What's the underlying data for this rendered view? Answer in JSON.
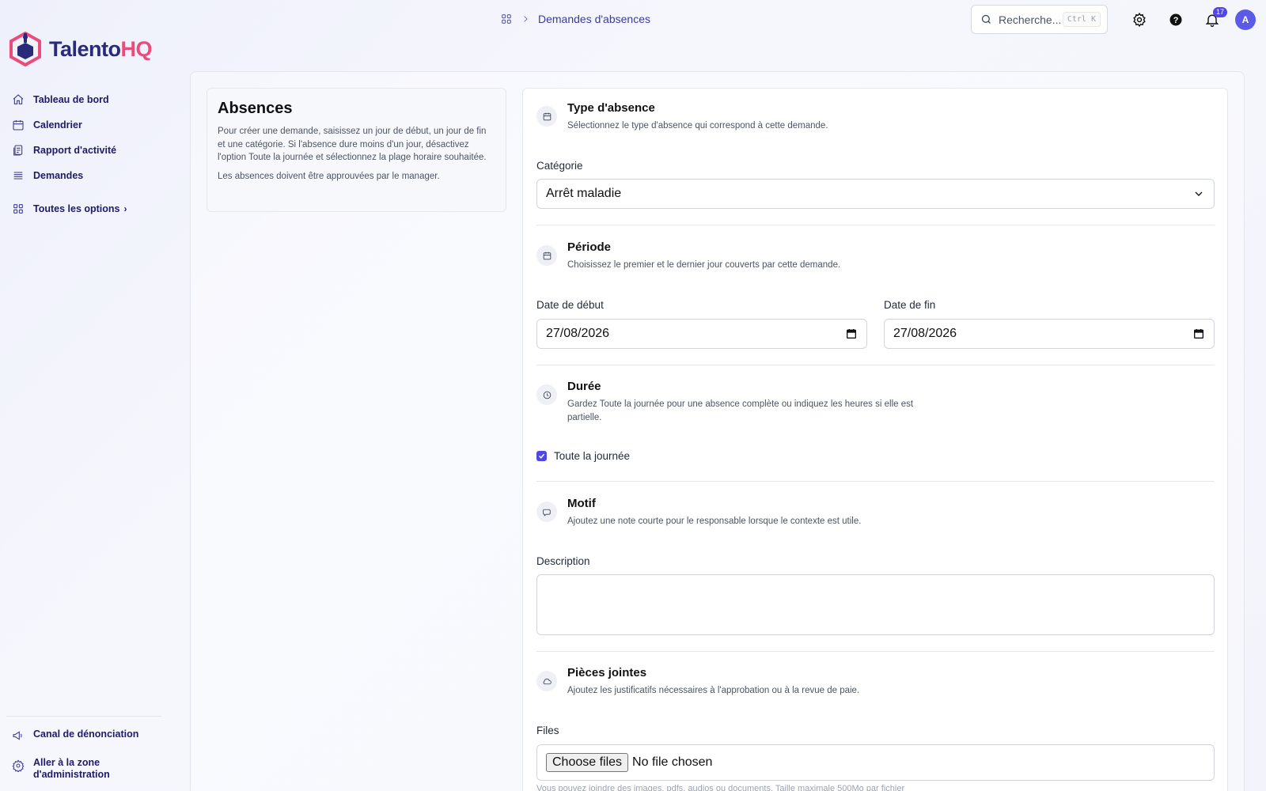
{
  "brand": {
    "name_part1": "Talento",
    "name_part2": "HQ"
  },
  "sidebar": {
    "items": [
      {
        "label": "Tableau de bord",
        "icon": "home-icon"
      },
      {
        "label": "Calendrier",
        "icon": "calendar-icon"
      },
      {
        "label": "Rapport d'activité",
        "icon": "report-icon"
      },
      {
        "label": "Demandes",
        "icon": "list-icon"
      }
    ],
    "all_options": "Toutes les options",
    "bottom": {
      "whistleblow": "Canal de dénonciation",
      "admin": "Aller à la zone d'administration"
    }
  },
  "topbar": {
    "breadcrumb": "Demandes d'absences",
    "search_placeholder": "Recherche...",
    "search_shortcut": "Ctrl K",
    "notification_count": "17",
    "avatar_initial": "A"
  },
  "info": {
    "title": "Absences",
    "paragraph1": "Pour créer une demande, saisissez un jour de début, un jour de fin et une catégorie. Si l'absence dure moins d'un jour, désactivez l'option Toute la journée et sélectionnez la plage horaire souhaitée.",
    "paragraph2": "Les absences doivent être approuvées par le manager."
  },
  "form": {
    "type": {
      "title": "Type d'absence",
      "desc": "Sélectionnez le type d'absence qui correspond à cette demande.",
      "category_label": "Catégorie",
      "category_value": "Arrêt maladie"
    },
    "period": {
      "title": "Période",
      "desc": "Choisissez le premier et le dernier jour couverts par cette demande.",
      "start_label": "Date de début",
      "start_value": "27/08/2026",
      "end_label": "Date de fin",
      "end_value": "27/08/2026"
    },
    "duration": {
      "title": "Durée",
      "desc": "Gardez Toute la journée pour une absence complète ou indiquez les heures si elle est partielle.",
      "all_day_label": "Toute la journée",
      "all_day_checked": true
    },
    "reason": {
      "title": "Motif",
      "desc": "Ajoutez une note courte pour le responsable lorsque le contexte est utile.",
      "description_label": "Description",
      "description_value": ""
    },
    "attachments": {
      "title": "Pièces jointes",
      "desc": "Ajoutez les justificatifs nécessaires à l'approbation ou à la revue de paie.",
      "files_label": "Files",
      "choose_button": "Choose files",
      "no_file": "No file chosen",
      "hint": "Vous pouvez joindre des images, pdfs, audios ou documents. Taille maximale 500Mo par fichier"
    }
  },
  "colors": {
    "accent": "#4f46e5",
    "brand_dark": "#2a2a7a",
    "brand_pink": "#ea4c7b"
  }
}
